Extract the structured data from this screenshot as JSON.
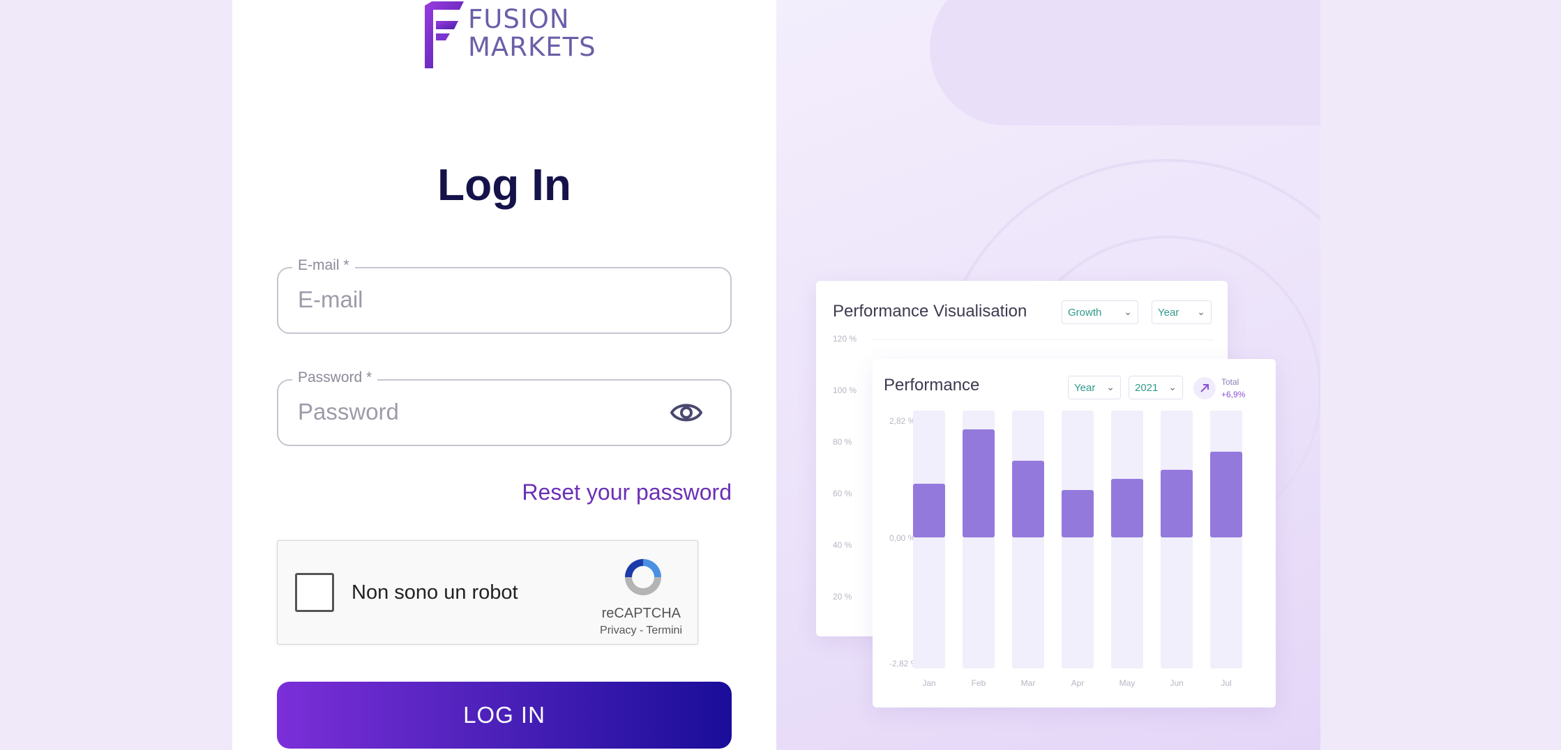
{
  "brand": {
    "line1": "FUSION",
    "line2": "MARKETS"
  },
  "login": {
    "title": "Log In",
    "email": {
      "legend": "E-mail *",
      "placeholder": "E-mail"
    },
    "password": {
      "legend": "Password *",
      "placeholder": "Password"
    },
    "reset_link": "Reset your password",
    "captcha": {
      "label": "Non sono un robot",
      "brand": "reCAPTCHA",
      "terms": "Privacy - Termini"
    },
    "submit": "LOG IN"
  },
  "colors": {
    "accent": "#6b2fb5",
    "title": "#15124a",
    "bar": "#9479dd"
  },
  "back_card": {
    "title": "Performance Visualisation",
    "dropdowns": [
      "Growth",
      "Year"
    ],
    "y_ticks": [
      "120 %",
      "100 %",
      "80 %",
      "60 %",
      "40 %",
      "20 %"
    ]
  },
  "front_card": {
    "title": "Performance",
    "dropdowns": [
      "Year",
      "2021"
    ],
    "total_label": "Total",
    "total_value": "+6,9%",
    "y_ticks": [
      "2,82 %",
      "0,00 %",
      "-2,82 %"
    ]
  },
  "chart_data": {
    "type": "bar",
    "title": "Performance",
    "categories": [
      "Jan",
      "Feb",
      "Mar",
      "Apr",
      "May",
      "Jun",
      "Jul"
    ],
    "values": [
      1.2,
      2.4,
      1.7,
      1.05,
      1.3,
      1.5,
      1.9
    ],
    "ylim": [
      -2.82,
      2.82
    ],
    "y_ticks": [
      "2,82 %",
      "0,00 %",
      "-2,82 %"
    ]
  }
}
